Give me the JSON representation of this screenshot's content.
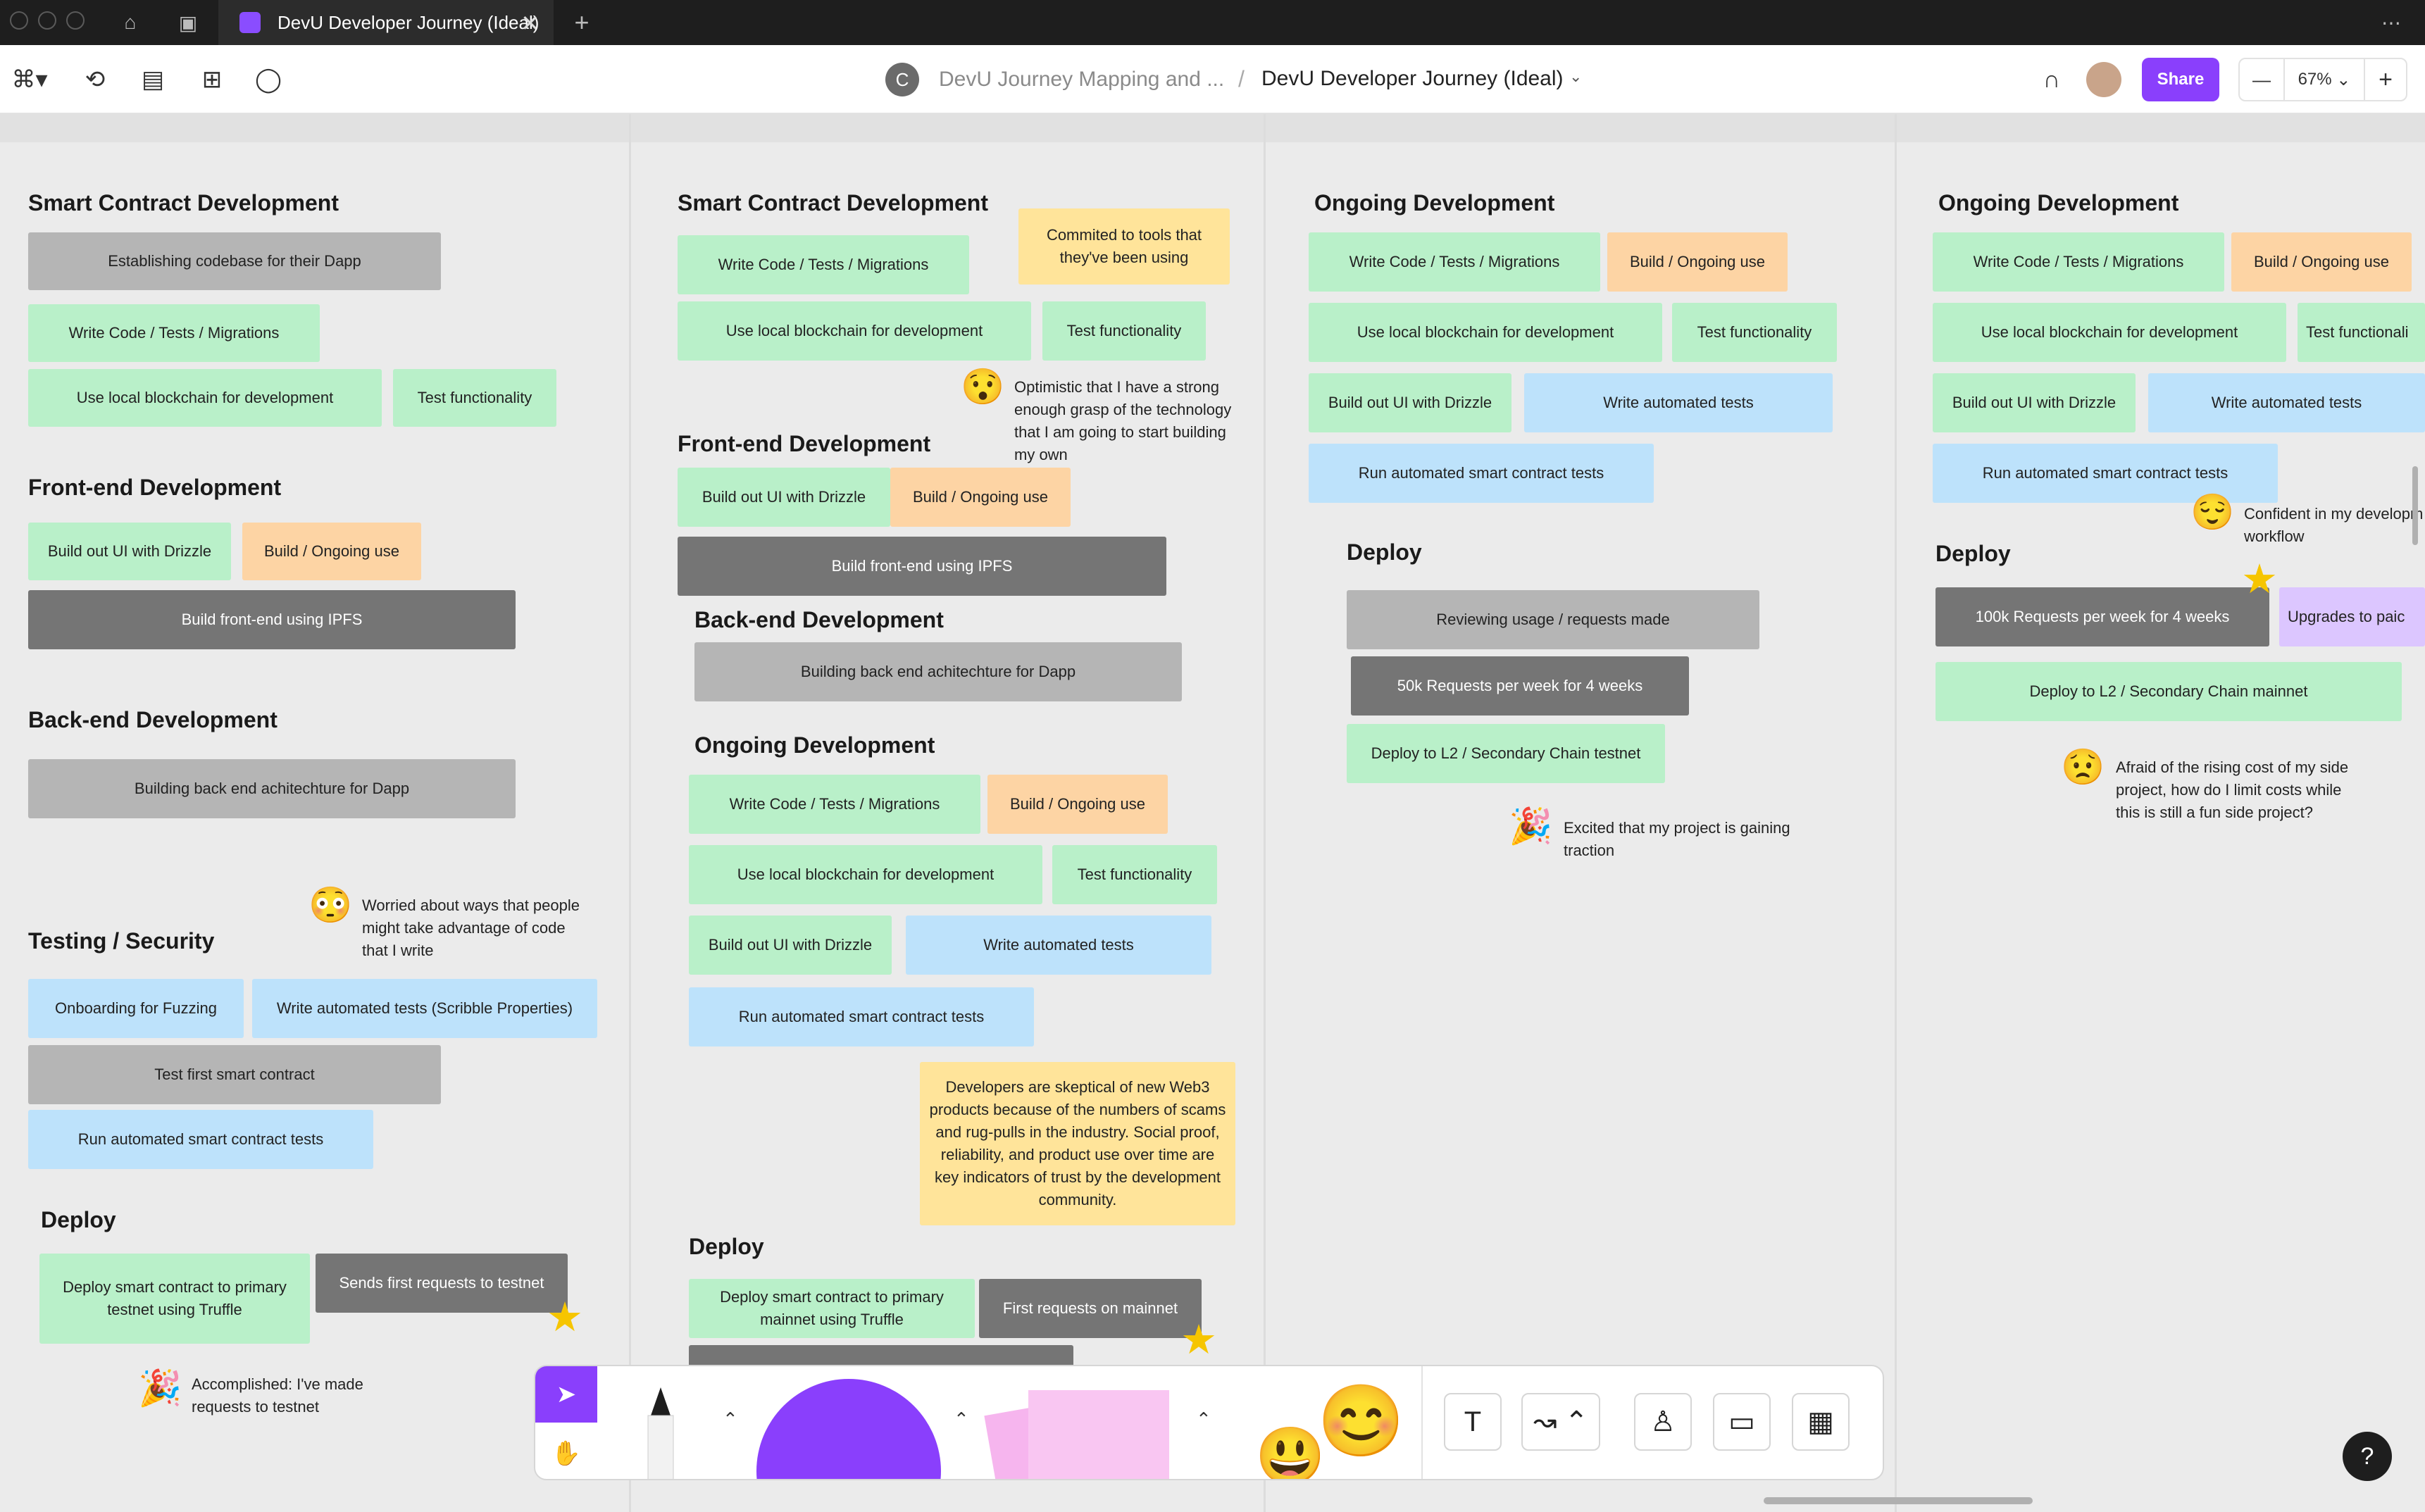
{
  "tab": {
    "title": "DevU Developer Journey (Ideal)",
    "close": "✕",
    "new": "+"
  },
  "toolbar": {
    "avatar_letter": "C",
    "breadcrumb_parent": "DevU Journey Mapping and ...",
    "breadcrumb_sep": "/",
    "file_title": "DevU Developer Journey (Ideal)",
    "share": "Share",
    "zoom": "67%",
    "zoom_minus": "—",
    "zoom_plus": "+"
  },
  "columns": [
    {
      "sections": [
        {
          "heading": "Smart Contract Development",
          "stickies": [
            "Establishing codebase for their Dapp",
            "Write Code / Tests / Migrations",
            "Use local blockchain for development",
            "Test functionality"
          ]
        },
        {
          "heading": "Front-end Development",
          "stickies": [
            "Build out UI with Drizzle",
            "Build / Ongoing use",
            "Build front-end using IPFS"
          ]
        },
        {
          "heading": "Back-end Development",
          "stickies": [
            "Building back end achitechture for Dapp"
          ]
        },
        {
          "heading": "Testing / Security",
          "stickies": [
            "Onboarding  for Fuzzing",
            "Write automated tests (Scribble Properties)",
            "Test first smart contract",
            "Run automated smart contract tests"
          ]
        },
        {
          "heading": "Deploy",
          "stickies": [
            "Deploy smart contract to  primary testnet using Truffle",
            "Sends first requests to testnet"
          ]
        }
      ],
      "notes": [
        "Worried about ways that people might take advantage of code that I write",
        "Accomplished: I've made requests to testnet"
      ]
    },
    {
      "sections": [
        {
          "heading": "Smart Contract Development",
          "stickies": [
            "Write Code / Tests / Migrations",
            "Commited to tools that they've been using",
            "Use local blockchain for development",
            "Test functionality"
          ]
        },
        {
          "heading": "Front-end Development",
          "stickies": [
            "Build out UI with Drizzle",
            "Build / Ongoing use",
            "Build front-end using IPFS"
          ]
        },
        {
          "heading": "Back-end Development",
          "stickies": [
            "Building back end achitechture for Dapp"
          ]
        },
        {
          "heading": "Ongoing Development",
          "stickies": [
            "Write Code / Tests / Migrations",
            "Build / Ongoing use",
            "Use local blockchain for development",
            "Test functionality",
            "Build out UI with Drizzle",
            "Write automated tests",
            "Run automated smart contract tests",
            "Developers are skeptical of new Web3 products because of the numbers of scams and rug-pulls in the industry. Social proof, reliability, and product use over time are key indicators of trust by the development community."
          ]
        },
        {
          "heading": "Deploy",
          "stickies": [
            "Deploy smart contract to  primary mainnet using Truffle",
            "First requests on mainnet"
          ]
        }
      ],
      "notes": [
        "Optimistic that I have a strong enough grasp of the technology that I am going to start building my own"
      ]
    },
    {
      "sections": [
        {
          "heading": "Ongoing Development",
          "stickies": [
            "Write Code / Tests / Migrations",
            "Build / Ongoing use",
            "Use local blockchain for development",
            "Test functionality",
            "Build out UI with Drizzle",
            "Write automated tests",
            "Run automated smart contract tests"
          ]
        },
        {
          "heading": "Deploy",
          "stickies": [
            "Reviewing usage / requests made",
            "50k Requests per week for 4 weeks",
            "Deploy to L2 / Secondary Chain testnet"
          ]
        }
      ],
      "notes": [
        "Excited that my project is gaining traction"
      ]
    },
    {
      "sections": [
        {
          "heading": "Ongoing Development",
          "stickies": [
            "Write Code / Tests / Migrations",
            "Build / Ongoing use",
            "Use local blockchain for development",
            "Test functionali",
            "Build out UI with Drizzle",
            "Write automated tests",
            "Run automated smart contract tests"
          ]
        },
        {
          "heading": "Deploy",
          "stickies": [
            "100k Requests per week for 4 weeks",
            "Upgrades to  paic",
            "Deploy to L2 / Secondary Chain mainnet"
          ]
        }
      ],
      "notes": [
        "Confident in my developm workflow",
        "Afraid of the rising cost of my side project, how do I limit costs while this is still a fun side project?"
      ]
    }
  ],
  "colors": {
    "accent": "#8a3ffc",
    "green": "#b9f0c9",
    "orange": "#fdd4a4",
    "blue": "#bde2fb",
    "grey": "#b5b5b5",
    "dark": "#757575",
    "yellow": "#ffe49a",
    "purple": "#dcc6ff"
  },
  "dock": {
    "help": "?"
  }
}
